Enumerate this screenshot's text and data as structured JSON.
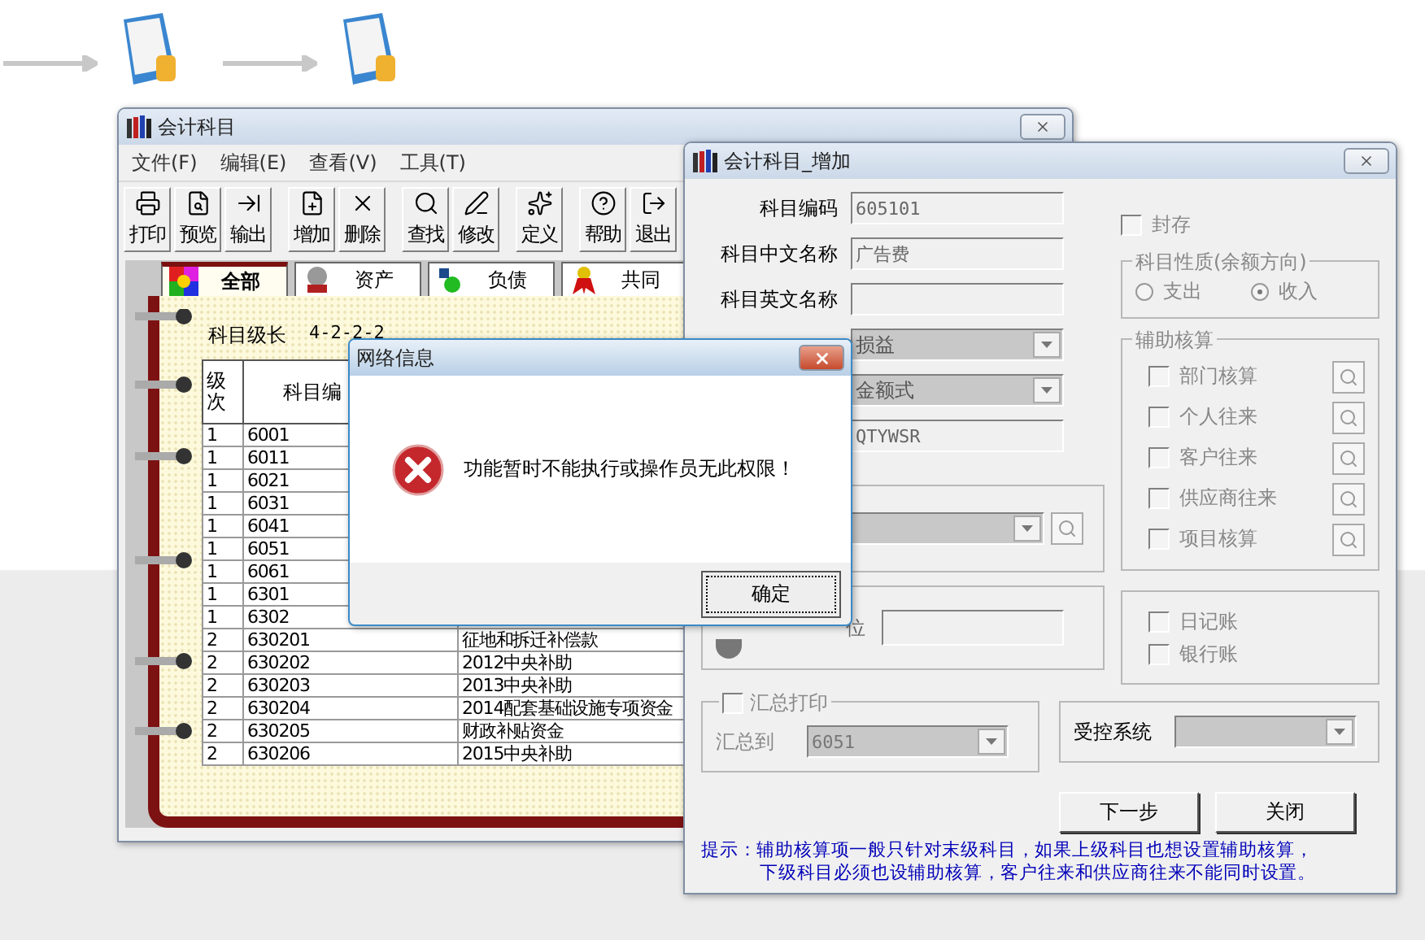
{
  "main_window": {
    "title": "会计科目",
    "menu": [
      "文件(F)",
      "编辑(E)",
      "查看(V)",
      "工具(T)"
    ],
    "toolbar": [
      [
        "打印",
        "预览",
        "输出"
      ],
      [
        "增加",
        "删除"
      ],
      [
        "查找",
        "修改"
      ],
      [
        "定义"
      ],
      [
        "帮助",
        "退出"
      ]
    ],
    "tabs": [
      {
        "label": "全部",
        "selected": true
      },
      {
        "label": "资产",
        "selected": false
      },
      {
        "label": "负债",
        "selected": false
      },
      {
        "label": "共同",
        "selected": false
      }
    ],
    "level_length": {
      "label": "科目级长",
      "value": "4-2-2-2"
    },
    "table": {
      "columns": [
        "级次",
        "科目编"
      ],
      "rows": [
        {
          "cells": [
            "1",
            "6001"
          ]
        },
        {
          "cells": [
            "1",
            "6011"
          ]
        },
        {
          "cells": [
            "1",
            "6021"
          ]
        },
        {
          "cells": [
            "1",
            "6031"
          ]
        },
        {
          "cells": [
            "1",
            "6041"
          ]
        },
        {
          "cells": [
            "1",
            "6051"
          ]
        },
        {
          "cells": [
            "1",
            "6061"
          ]
        },
        {
          "cells": [
            "1",
            "6301"
          ]
        },
        {
          "cells": [
            "1",
            "6302"
          ]
        },
        {
          "cells": [
            "2",
            "630201",
            "征地和拆迁补偿款"
          ]
        },
        {
          "cells": [
            "2",
            "630202",
            "2012中央补助"
          ]
        },
        {
          "cells": [
            "2",
            "630203",
            "2013中央补助"
          ]
        },
        {
          "cells": [
            "2",
            "630204",
            "2014配套基础设施专项资金"
          ]
        },
        {
          "cells": [
            "2",
            "630205",
            "财政补贴资金"
          ]
        },
        {
          "cells": [
            "2",
            "630206",
            "2015中央补助"
          ]
        }
      ]
    }
  },
  "add_window": {
    "title": "会计科目_增加",
    "fields": [
      {
        "kind": "text",
        "label": "科目编码",
        "value": "605101"
      },
      {
        "kind": "text",
        "label": "科目中文名称",
        "value": "广告费"
      },
      {
        "kind": "text",
        "label": "科目英文名称"
      },
      {
        "kind": "combo",
        "value": "损益"
      },
      {
        "kind": "combo",
        "value": "金额式"
      },
      {
        "kind": "text",
        "value": "QTYWSR"
      }
    ],
    "unit_label": "位",
    "archived": {
      "label": "封存",
      "checked": false
    },
    "nature": {
      "title": "科目性质(余额方向)",
      "options": [
        {
          "label": "支出",
          "selected": false
        },
        {
          "label": "收入",
          "selected": true
        }
      ]
    },
    "aux": {
      "title": "辅助核算",
      "items": [
        {
          "label": "部门核算",
          "checked": false
        },
        {
          "label": "个人往来",
          "checked": false
        },
        {
          "label": "客户往来",
          "checked": false
        },
        {
          "label": "供应商往来",
          "checked": false
        },
        {
          "label": "项目核算",
          "checked": false
        }
      ]
    },
    "ledgers": [
      {
        "label": "日记账",
        "checked": false
      },
      {
        "label": "银行账",
        "checked": false
      }
    ],
    "summary": {
      "label": "汇总打印",
      "checked": false,
      "target_label": "汇总到",
      "target_value": "6051"
    },
    "control": {
      "label": "受控系统"
    },
    "buttons": [
      "下一步",
      "关闭"
    ],
    "hint": [
      "提示：辅助核算项一般只针对末级科目，如果上级科目也想设置辅助核算，",
      "下级科目必须也设辅助核算，客户往来和供应商往来不能同时设置。"
    ]
  },
  "dialog": {
    "title": "网络信息",
    "message": "功能暂时不能执行或操作员无此权限！",
    "button": "确定"
  }
}
